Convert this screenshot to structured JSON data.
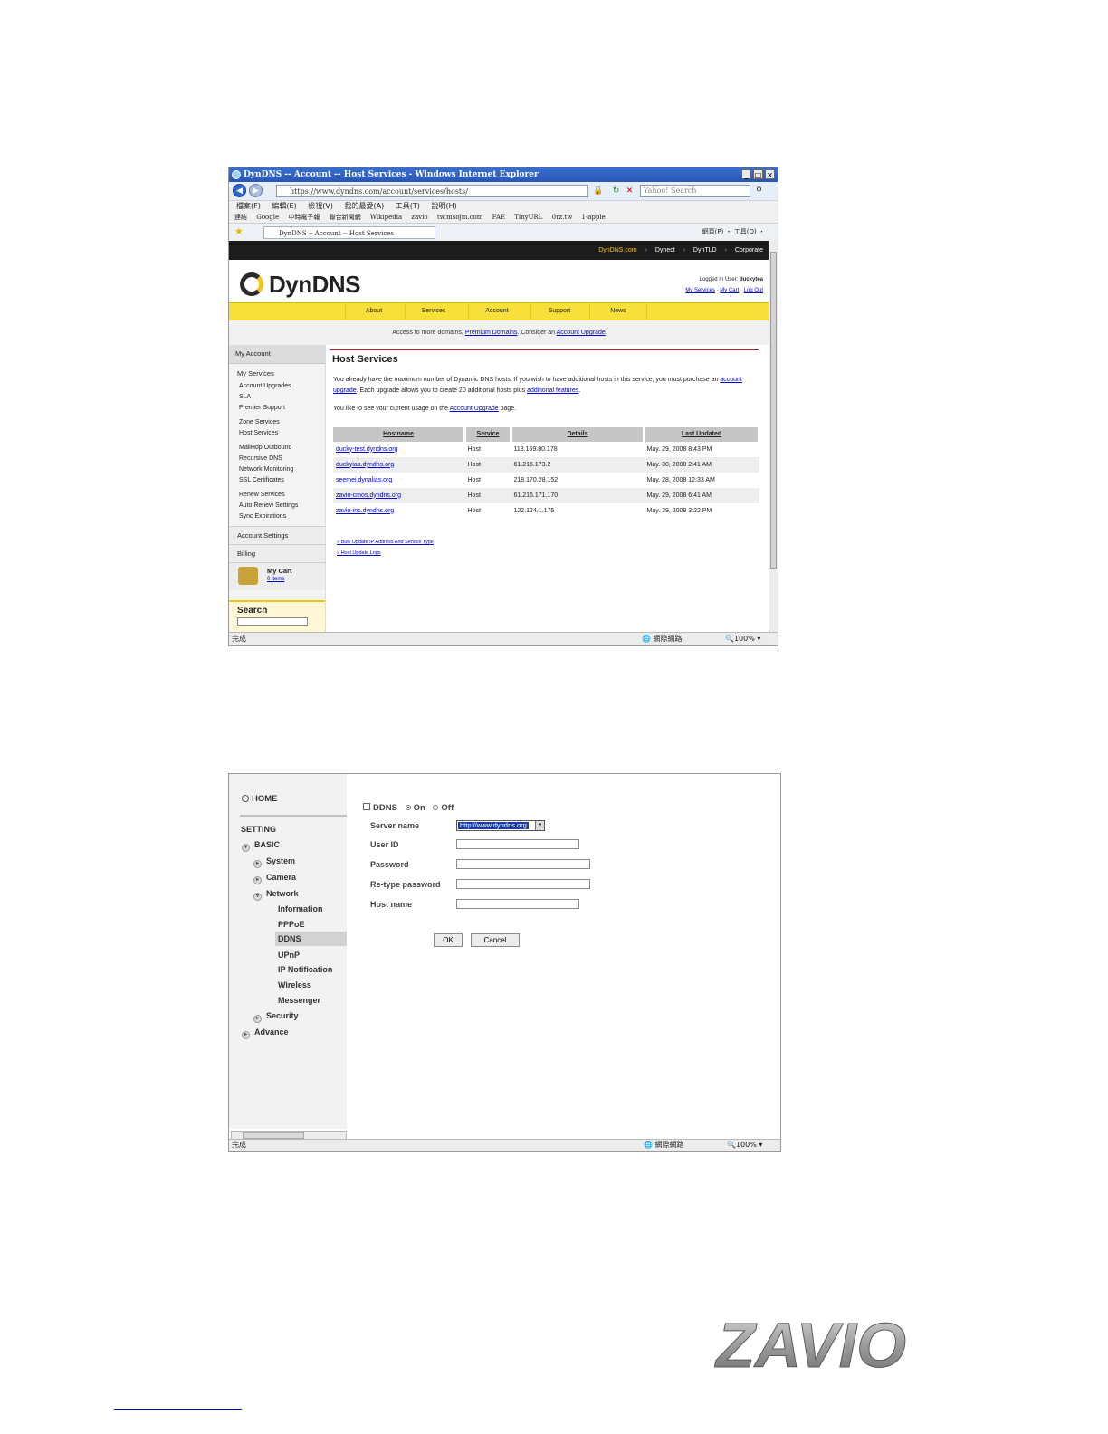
{
  "ie_window": {
    "title": "DynDNS -- Account -- Host Services - Windows Internet Explorer",
    "address": "https://www.dyndns.com/account/services/hosts/",
    "search_placeholder": "Yahoo! Search",
    "menu": [
      "檔案(F)",
      "編輯(E)",
      "檢視(V)",
      "我的最愛(A)",
      "工具(T)",
      "說明(H)"
    ],
    "favorites": [
      "連結",
      "Google",
      "中時電子報",
      "聯合新聞網",
      "Wikipedia",
      "zavio",
      "tw.msojm.com",
      "FAE",
      "TinyURL",
      "0rz.tw",
      "1-apple"
    ],
    "tab_title": "DynDNS -- Account -- Host Services",
    "toolbar_tools": "網頁(P) ・ 工具(O) ・",
    "status_left": "完成",
    "status_zone": "網際網路",
    "status_zoom": "100%"
  },
  "dyndns": {
    "topnav": [
      "DynDNS.com",
      "Dynect",
      "DynTLD",
      "Corporate"
    ],
    "logo_text": "DynDNS",
    "logged_in_label": "Logged In User:",
    "logged_in_user": "duckytea",
    "user_links": [
      "My Services",
      "My Cart",
      "Log Out"
    ],
    "nav": [
      "About",
      "Services",
      "Account",
      "Support",
      "News"
    ],
    "banner_prefix": "Access to more domains,",
    "banner_link1": "Premium Domains",
    "banner_mid": ". Consider an",
    "banner_link2": "Account Upgrade",
    "banner_suffix": ".",
    "sidebar": {
      "header": "My Account",
      "section": "My Services",
      "groups": [
        [
          "Account Upgrades",
          "SLA",
          "Premier Support"
        ],
        [
          "Zone Services",
          "Host Services"
        ],
        [
          "MailHop Outbound",
          "Recursive DNS",
          "Network Monitoring",
          "SSL Certificates"
        ],
        [
          "Renew Services",
          "Auto Renew Settings",
          "Sync Expirations"
        ]
      ],
      "account_settings": "Account Settings",
      "billing": "Billing",
      "cart_title": "My Cart",
      "cart_items": "0 items",
      "search_label": "Search"
    },
    "main": {
      "heading": "Host Services",
      "p1_text": "You already have the maximum number of Dynamic DNS hosts. If you wish to have additional hosts in this service, you must purchase an",
      "p1_link1": "account upgrade",
      "p1_mid": ". Each upgrade allows you to create 20 additional hosts plus",
      "p1_link2": "additional features",
      "p1_end": ".",
      "p2_text": "You like to see your current usage on the",
      "p2_link": "Account Upgrade",
      "p2_end": "page.",
      "columns": [
        "Hostname",
        "Service",
        "Details",
        "Last Updated"
      ],
      "rows": [
        [
          "ducky-test.dyndns.org",
          "Host",
          "118.169.80.178",
          "May. 29, 2008 8:43 PM"
        ],
        [
          "duckyiaa.dyndns.org",
          "Host",
          "61.216.173.2",
          "May. 30, 2008 2:41 AM"
        ],
        [
          "seemei.dynalias.org",
          "Host",
          "218.170.28.152",
          "May. 28, 2008 12:33 AM"
        ],
        [
          "zavio-cmos.dyndns.org",
          "Host",
          "61.216.171.170",
          "May. 29, 2008 6:41 AM"
        ],
        [
          "zavio-inc.dyndns.org",
          "Host",
          "122.124.1.175",
          "May. 29, 2008 3:22 PM"
        ]
      ],
      "footer_links": [
        "» Bulk Update IP Address And Service Type",
        "» Host Update Logs"
      ]
    }
  },
  "camera": {
    "home": "HOME",
    "setting": "SETTING",
    "basic": "BASIC",
    "system": "System",
    "camera": "Camera",
    "network": "Network",
    "network_items": [
      "Information",
      "PPPoE",
      "DDNS",
      "UPnP",
      "IP Notification",
      "Wireless",
      "Messenger"
    ],
    "security": "Security",
    "advance": "Advance",
    "ddns_label": "DDNS",
    "on_label": "On",
    "off_label": "Off",
    "server_name_label": "Server name",
    "server_name_value": "http://www.dyndns.org",
    "user_id_label": "User ID",
    "password_label": "Password",
    "retype_label": "Re-type password",
    "host_name_label": "Host name",
    "ok_label": "OK",
    "cancel_label": "Cancel",
    "status_left": "完成",
    "status_zone": "網際網路",
    "status_zoom": "100%"
  },
  "footer": {
    "logo_text": "ZAVIO"
  },
  "colors": {
    "dyndns_yellow": "#f8df3a",
    "link_blue": "#0000cc",
    "ie_title_blue": "#2a56b3"
  }
}
